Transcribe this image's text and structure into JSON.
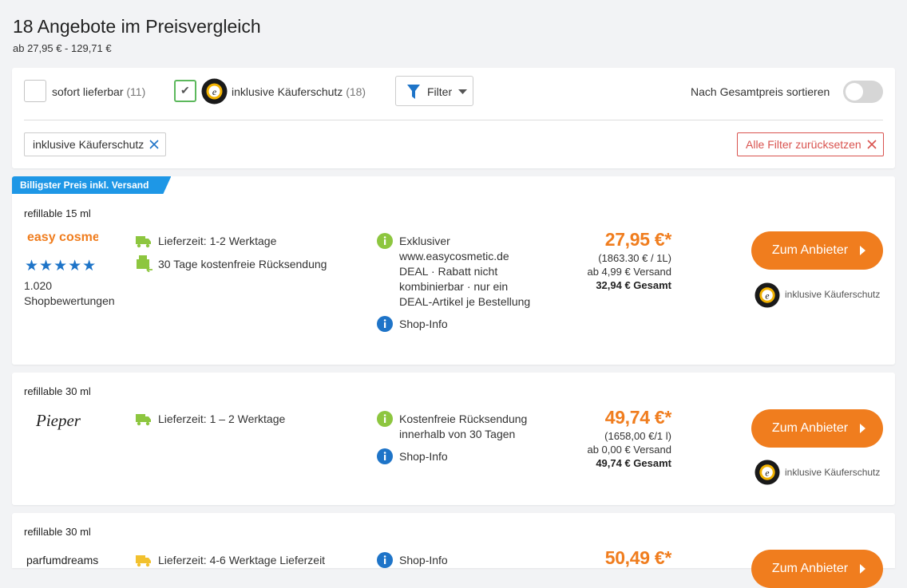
{
  "header": {
    "title": "18 Angebote im Preisvergleich",
    "subtitle": "ab 27,95 € - 129,71 €"
  },
  "filters": {
    "sofort_label": "sofort lieferbar",
    "sofort_count": "(11)",
    "kaeuferschutz_label": "inklusive Käuferschutz",
    "kaeuferschutz_count": "(18)",
    "filter_button": "Filter",
    "sort_label": "Nach Gesamtpreis sortieren",
    "active_chip": "inklusive Käuferschutz",
    "reset_label": "Alle Filter zurücksetzen"
  },
  "colors": {
    "accent_orange": "#f07d1e",
    "ribbon_blue": "#1e97e6",
    "check_green": "#5cb85c",
    "reset_red": "#d9534f"
  },
  "offers": [
    {
      "ribbon": "Billigster Preis inkl. Versand",
      "variant": "refillable 15 ml",
      "shop_logo": "easy cosmetic",
      "rating_count": "1.020",
      "rating_label": "Shopbewertungen",
      "delivery": "Lieferzeit: 1-2 Werktage",
      "returns": "30 Tage kostenfreie Rücksendung",
      "info_lines": [
        "Exklusiver",
        "www.easycosmetic.de",
        "DEAL · Rabatt nicht",
        "kombinierbar · nur ein",
        "DEAL-Artikel je Bestellung"
      ],
      "shop_info": "Shop-Info",
      "price": "27,95 €*",
      "unit_price": "(1863.30 € / 1L)",
      "shipping": "ab 4,99 € Versand",
      "total": "32,94 € Gesamt",
      "cta": "Zum Anbieter",
      "protection": "inklusive Käuferschutz"
    },
    {
      "variant": "refillable 30 ml",
      "shop_logo": "Pieper",
      "delivery": "Lieferzeit: 1 – 2 Werktage",
      "info_lines": [
        "Kostenfreie Rücksendung",
        "innerhalb von 30 Tagen"
      ],
      "shop_info": "Shop-Info",
      "price": "49,74 €*",
      "unit_price": "(1658,00 €/1 l)",
      "shipping": "ab 0,00 € Versand",
      "total": "49,74 € Gesamt",
      "cta": "Zum Anbieter",
      "protection": "inklusive Käuferschutz"
    },
    {
      "variant": "refillable 30 ml",
      "shop_logo": "parfumdreams",
      "delivery": "Lieferzeit: 4-6 Werktage Lieferzeit",
      "shop_info": "Shop-Info",
      "price": "50,49 €*",
      "cta": "Zum Anbieter"
    }
  ]
}
